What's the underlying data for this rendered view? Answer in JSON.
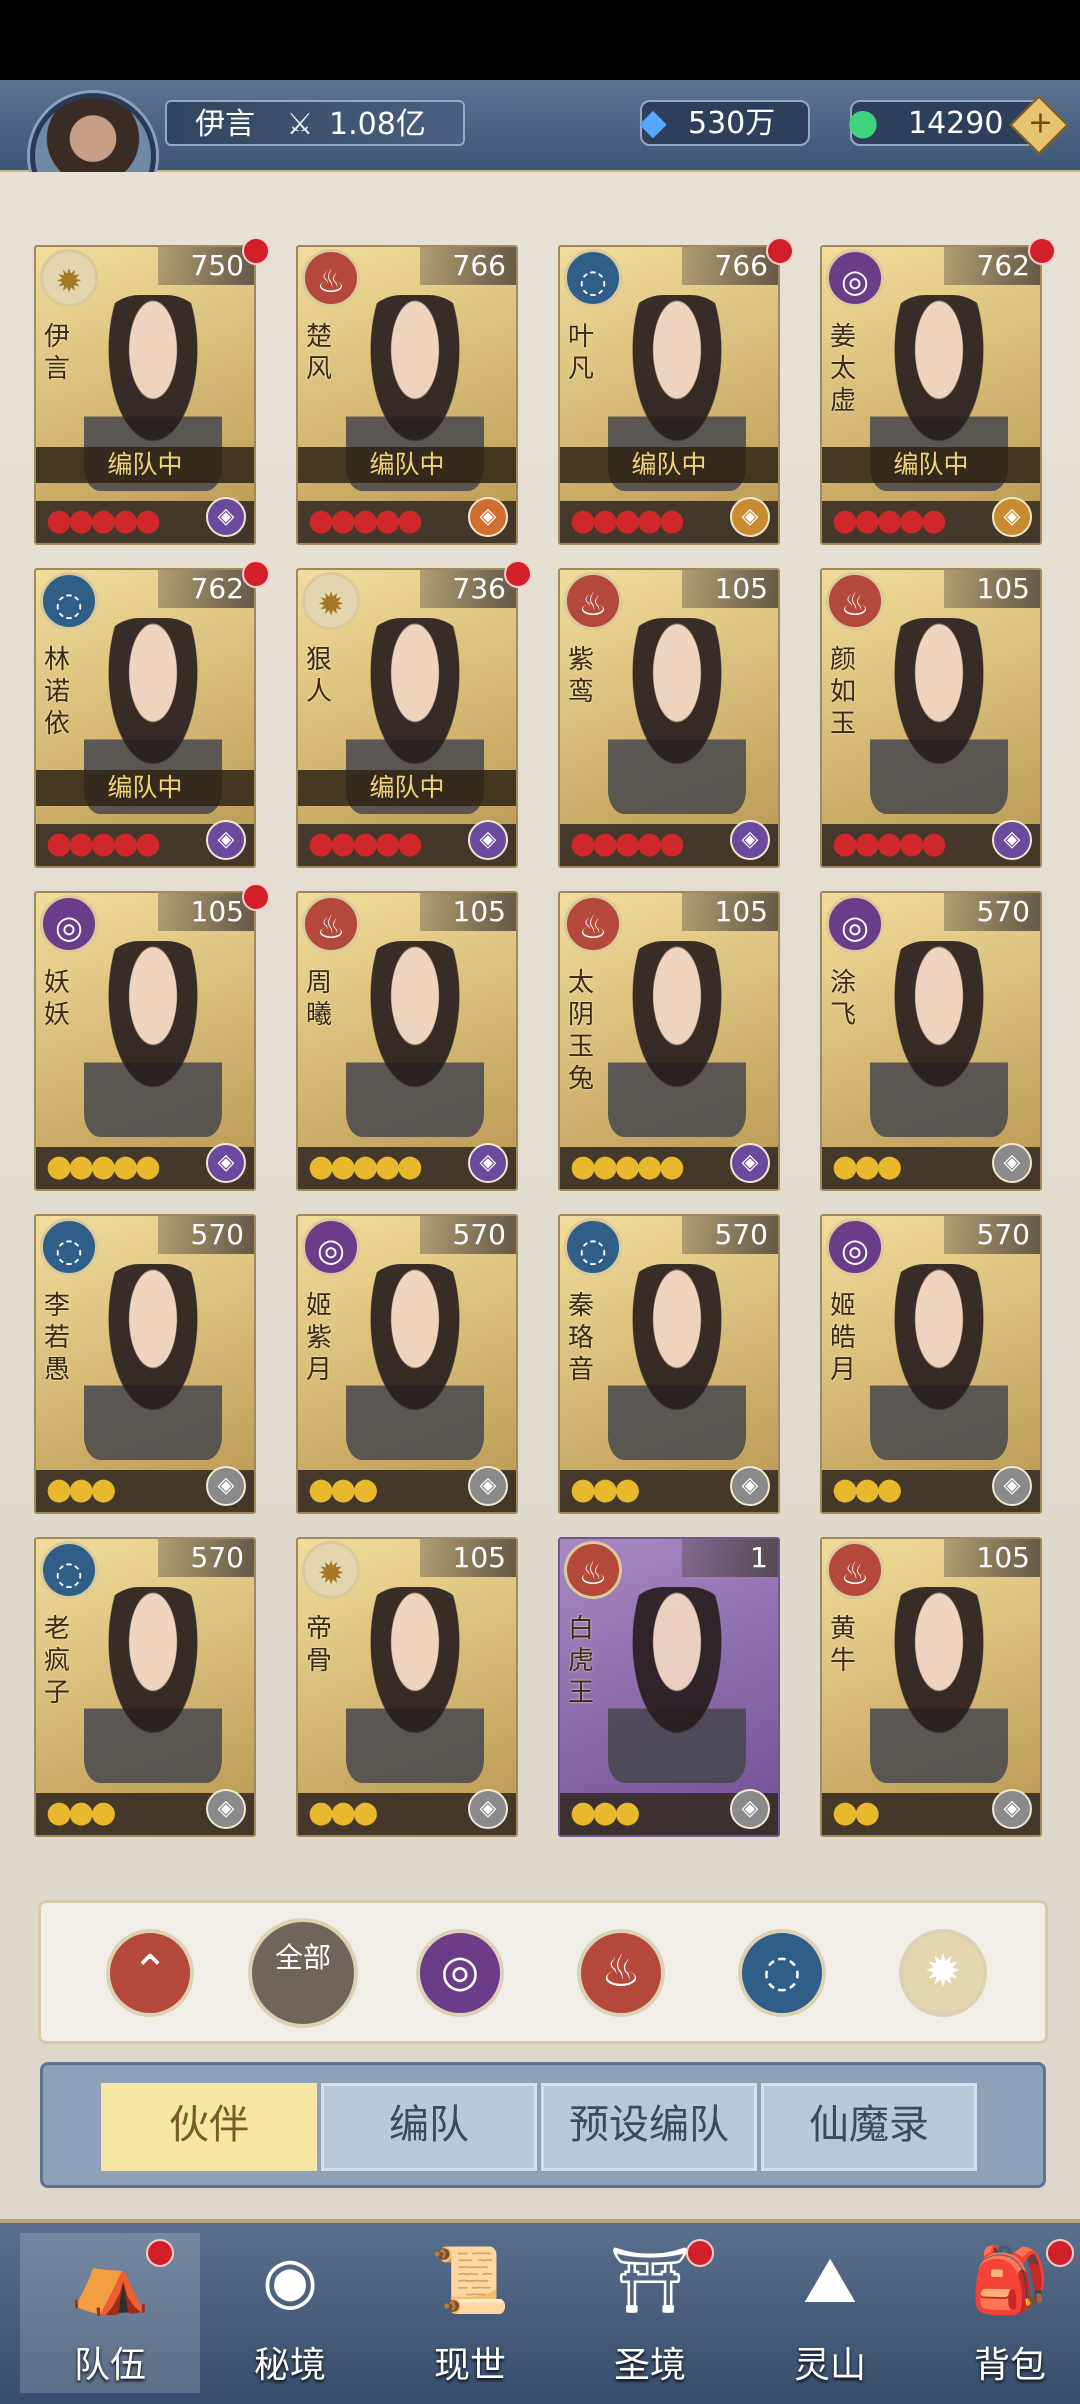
{
  "header": {
    "player_name": "伊言",
    "power_value": "1.08亿",
    "power_icon": "⚔",
    "crystal_value": "530万",
    "crystal_icon": "◆",
    "jade_value": "14290",
    "jade_icon": "●",
    "add_icon": "+"
  },
  "cards": [
    {
      "name": "伊言",
      "level": "750",
      "element": "light",
      "stars": "●●●●●",
      "star_color": "red",
      "tag": "编队中",
      "rank": "purple",
      "dot": true
    },
    {
      "name": "楚风",
      "level": "766",
      "element": "fire",
      "stars": "●●●●●",
      "star_color": "red",
      "tag": "编队中",
      "rank": "orange",
      "dot": false
    },
    {
      "name": "叶凡",
      "level": "766",
      "element": "water",
      "stars": "●●●●●",
      "star_color": "red",
      "tag": "编队中",
      "rank": "gold",
      "dot": true
    },
    {
      "name": "姜太虚",
      "level": "762",
      "element": "dark",
      "stars": "●●●●●",
      "star_color": "red",
      "tag": "编队中",
      "rank": "gold",
      "dot": true
    },
    {
      "name": "林诺依",
      "level": "762",
      "element": "water",
      "stars": "●●●●●",
      "star_color": "red",
      "tag": "编队中",
      "rank": "purple",
      "dot": true
    },
    {
      "name": "狠人",
      "level": "736",
      "element": "light",
      "stars": "●●●●●",
      "star_color": "red",
      "tag": "编队中",
      "rank": "purple",
      "dot": true
    },
    {
      "name": "紫鸾",
      "level": "105",
      "element": "fire",
      "stars": "●●●●●",
      "star_color": "red",
      "tag": "",
      "rank": "purple",
      "dot": false
    },
    {
      "name": "颜如玉",
      "level": "105",
      "element": "fire",
      "stars": "●●●●●",
      "star_color": "red",
      "tag": "",
      "rank": "purple",
      "dot": false
    },
    {
      "name": "妖妖",
      "level": "105",
      "element": "dark",
      "stars": "●●●●●",
      "star_color": "mixed",
      "tag": "",
      "rank": "purple",
      "dot": true
    },
    {
      "name": "周曦",
      "level": "105",
      "element": "fire",
      "stars": "●●●●●",
      "star_color": "gold",
      "tag": "",
      "rank": "purple",
      "dot": false
    },
    {
      "name": "太阴玉兔",
      "level": "105",
      "element": "fire",
      "stars": "●●●●●",
      "star_color": "gold",
      "tag": "",
      "rank": "purple",
      "dot": false
    },
    {
      "name": "涂飞",
      "level": "570",
      "element": "dark",
      "stars": "●●●",
      "star_color": "gold",
      "tag": "",
      "rank": "gray",
      "dot": false
    },
    {
      "name": "李若愚",
      "level": "570",
      "element": "water",
      "stars": "●●●",
      "star_color": "gold",
      "tag": "",
      "rank": "gray",
      "dot": false
    },
    {
      "name": "姬紫月",
      "level": "570",
      "element": "dark",
      "stars": "●●●",
      "star_color": "gold",
      "tag": "",
      "rank": "gray",
      "dot": false
    },
    {
      "name": "秦珞音",
      "level": "570",
      "element": "water",
      "stars": "●●●",
      "star_color": "gold",
      "tag": "",
      "rank": "gray",
      "dot": false
    },
    {
      "name": "姬皓月",
      "level": "570",
      "element": "dark",
      "stars": "●●●",
      "star_color": "gold",
      "tag": "",
      "rank": "gray",
      "dot": false
    },
    {
      "name": "老疯子",
      "level": "570",
      "element": "water",
      "stars": "●●●",
      "star_color": "gold",
      "tag": "",
      "rank": "gray",
      "dot": false
    },
    {
      "name": "帝骨",
      "level": "105",
      "element": "light",
      "stars": "●●●",
      "star_color": "gold",
      "tag": "",
      "rank": "gray",
      "dot": false
    },
    {
      "name": "白虎王",
      "level": "1",
      "element": "fire",
      "stars": "●●●",
      "star_color": "gold",
      "tag": "",
      "rank": "gray",
      "dot": false
    },
    {
      "name": "黄牛",
      "level": "105",
      "element": "fire",
      "stars": "●●",
      "star_color": "gold",
      "tag": "",
      "rank": "gray",
      "dot": false
    }
  ],
  "filters": [
    {
      "name": "filter-up-icon",
      "label": "",
      "icon": "⌃"
    },
    {
      "name": "filter-all-button",
      "label": "全部",
      "icon": ""
    },
    {
      "name": "filter-dark-icon",
      "label": "",
      "icon": "◎"
    },
    {
      "name": "filter-fire-icon",
      "label": "",
      "icon": "♨"
    },
    {
      "name": "filter-water-icon",
      "label": "",
      "icon": "◌"
    },
    {
      "name": "filter-light-icon",
      "label": "",
      "icon": "✹"
    }
  ],
  "tabs": [
    "伙伴",
    "编队",
    "预设编队",
    "仙魔录"
  ],
  "nav": [
    {
      "label": "队伍",
      "icon": "⛺",
      "dot": true
    },
    {
      "label": "秘境",
      "icon": "◉",
      "dot": false
    },
    {
      "label": "现世",
      "icon": "📜",
      "dot": false
    },
    {
      "label": "圣境",
      "icon": "⛩",
      "dot": true
    },
    {
      "label": "灵山",
      "icon": "⛰",
      "dot": false
    },
    {
      "label": "背包",
      "icon": "🎒",
      "dot": true
    }
  ]
}
